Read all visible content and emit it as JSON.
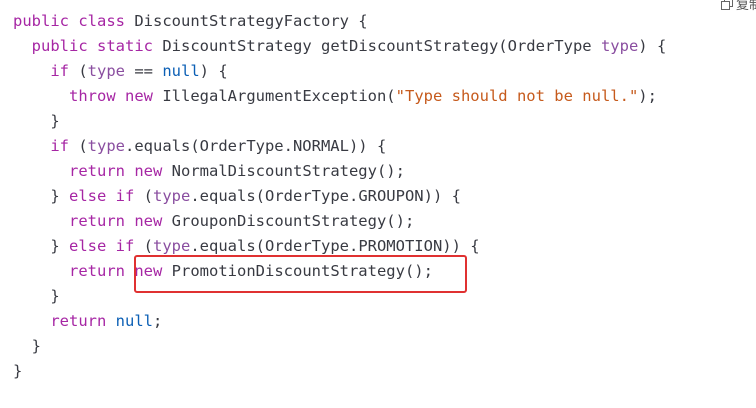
{
  "copy_button": {
    "label": "复制",
    "icon": "copy-icon"
  },
  "code_lines": [
    [
      {
        "t": "public",
        "c": "kw"
      },
      {
        "t": " ",
        "c": "plain"
      },
      {
        "t": "class",
        "c": "kw"
      },
      {
        "t": " DiscountStrategyFactory {",
        "c": "plain"
      }
    ],
    [
      {
        "t": "  ",
        "c": "plain"
      },
      {
        "t": "public",
        "c": "kw"
      },
      {
        "t": " ",
        "c": "plain"
      },
      {
        "t": "static",
        "c": "kw"
      },
      {
        "t": " DiscountStrategy getDiscountStrategy(OrderType ",
        "c": "plain"
      },
      {
        "t": "type",
        "c": "var"
      },
      {
        "t": ") {",
        "c": "plain"
      }
    ],
    [
      {
        "t": "    ",
        "c": "plain"
      },
      {
        "t": "if",
        "c": "kw"
      },
      {
        "t": " (",
        "c": "plain"
      },
      {
        "t": "type",
        "c": "var"
      },
      {
        "t": " == ",
        "c": "plain"
      },
      {
        "t": "null",
        "c": "lit"
      },
      {
        "t": ") {",
        "c": "plain"
      }
    ],
    [
      {
        "t": "      ",
        "c": "plain"
      },
      {
        "t": "throw",
        "c": "kw"
      },
      {
        "t": " ",
        "c": "plain"
      },
      {
        "t": "new",
        "c": "kw"
      },
      {
        "t": " IllegalArgumentException(",
        "c": "plain"
      },
      {
        "t": "\"Type should not be null.\"",
        "c": "str"
      },
      {
        "t": ");",
        "c": "plain"
      }
    ],
    [
      {
        "t": "    }",
        "c": "plain"
      }
    ],
    [
      {
        "t": "    ",
        "c": "plain"
      },
      {
        "t": "if",
        "c": "kw"
      },
      {
        "t": " (",
        "c": "plain"
      },
      {
        "t": "type",
        "c": "var"
      },
      {
        "t": ".equals(OrderType.NORMAL)) {",
        "c": "plain"
      }
    ],
    [
      {
        "t": "      ",
        "c": "plain"
      },
      {
        "t": "return",
        "c": "kw"
      },
      {
        "t": " ",
        "c": "plain"
      },
      {
        "t": "new",
        "c": "kw"
      },
      {
        "t": " NormalDiscountStrategy();",
        "c": "plain"
      }
    ],
    [
      {
        "t": "    } ",
        "c": "plain"
      },
      {
        "t": "else",
        "c": "kw"
      },
      {
        "t": " ",
        "c": "plain"
      },
      {
        "t": "if",
        "c": "kw"
      },
      {
        "t": " (",
        "c": "plain"
      },
      {
        "t": "type",
        "c": "var"
      },
      {
        "t": ".equals(OrderType.GROUPON)) {",
        "c": "plain"
      }
    ],
    [
      {
        "t": "      ",
        "c": "plain"
      },
      {
        "t": "return",
        "c": "kw"
      },
      {
        "t": " ",
        "c": "plain"
      },
      {
        "t": "new",
        "c": "kw"
      },
      {
        "t": " GrouponDiscountStrategy();",
        "c": "plain"
      }
    ],
    [
      {
        "t": "    } ",
        "c": "plain"
      },
      {
        "t": "else",
        "c": "kw"
      },
      {
        "t": " ",
        "c": "plain"
      },
      {
        "t": "if",
        "c": "kw"
      },
      {
        "t": " (",
        "c": "plain"
      },
      {
        "t": "type",
        "c": "var"
      },
      {
        "t": ".equals(OrderType.PROMOTION)) {",
        "c": "plain"
      }
    ],
    [
      {
        "t": "      ",
        "c": "plain"
      },
      {
        "t": "return",
        "c": "kw"
      },
      {
        "t": " ",
        "c": "plain"
      },
      {
        "t": "new",
        "c": "kw"
      },
      {
        "t": " PromotionDiscountStrategy();",
        "c": "plain"
      }
    ],
    [
      {
        "t": "    }",
        "c": "plain"
      }
    ],
    [
      {
        "t": "    ",
        "c": "plain"
      },
      {
        "t": "return",
        "c": "kw"
      },
      {
        "t": " ",
        "c": "plain"
      },
      {
        "t": "null",
        "c": "lit"
      },
      {
        "t": ";",
        "c": "plain"
      }
    ],
    [
      {
        "t": "  }",
        "c": "plain"
      }
    ],
    [
      {
        "t": "}",
        "c": "plain"
      }
    ]
  ],
  "highlight": {
    "line_index": 10,
    "color": "#e03131"
  },
  "colors": {
    "keyword": "#a626a4",
    "string": "#c65a1c",
    "literal": "#0b5fb5",
    "variable": "#8a4ea0",
    "text": "#383a42",
    "background": "#ffffff"
  }
}
